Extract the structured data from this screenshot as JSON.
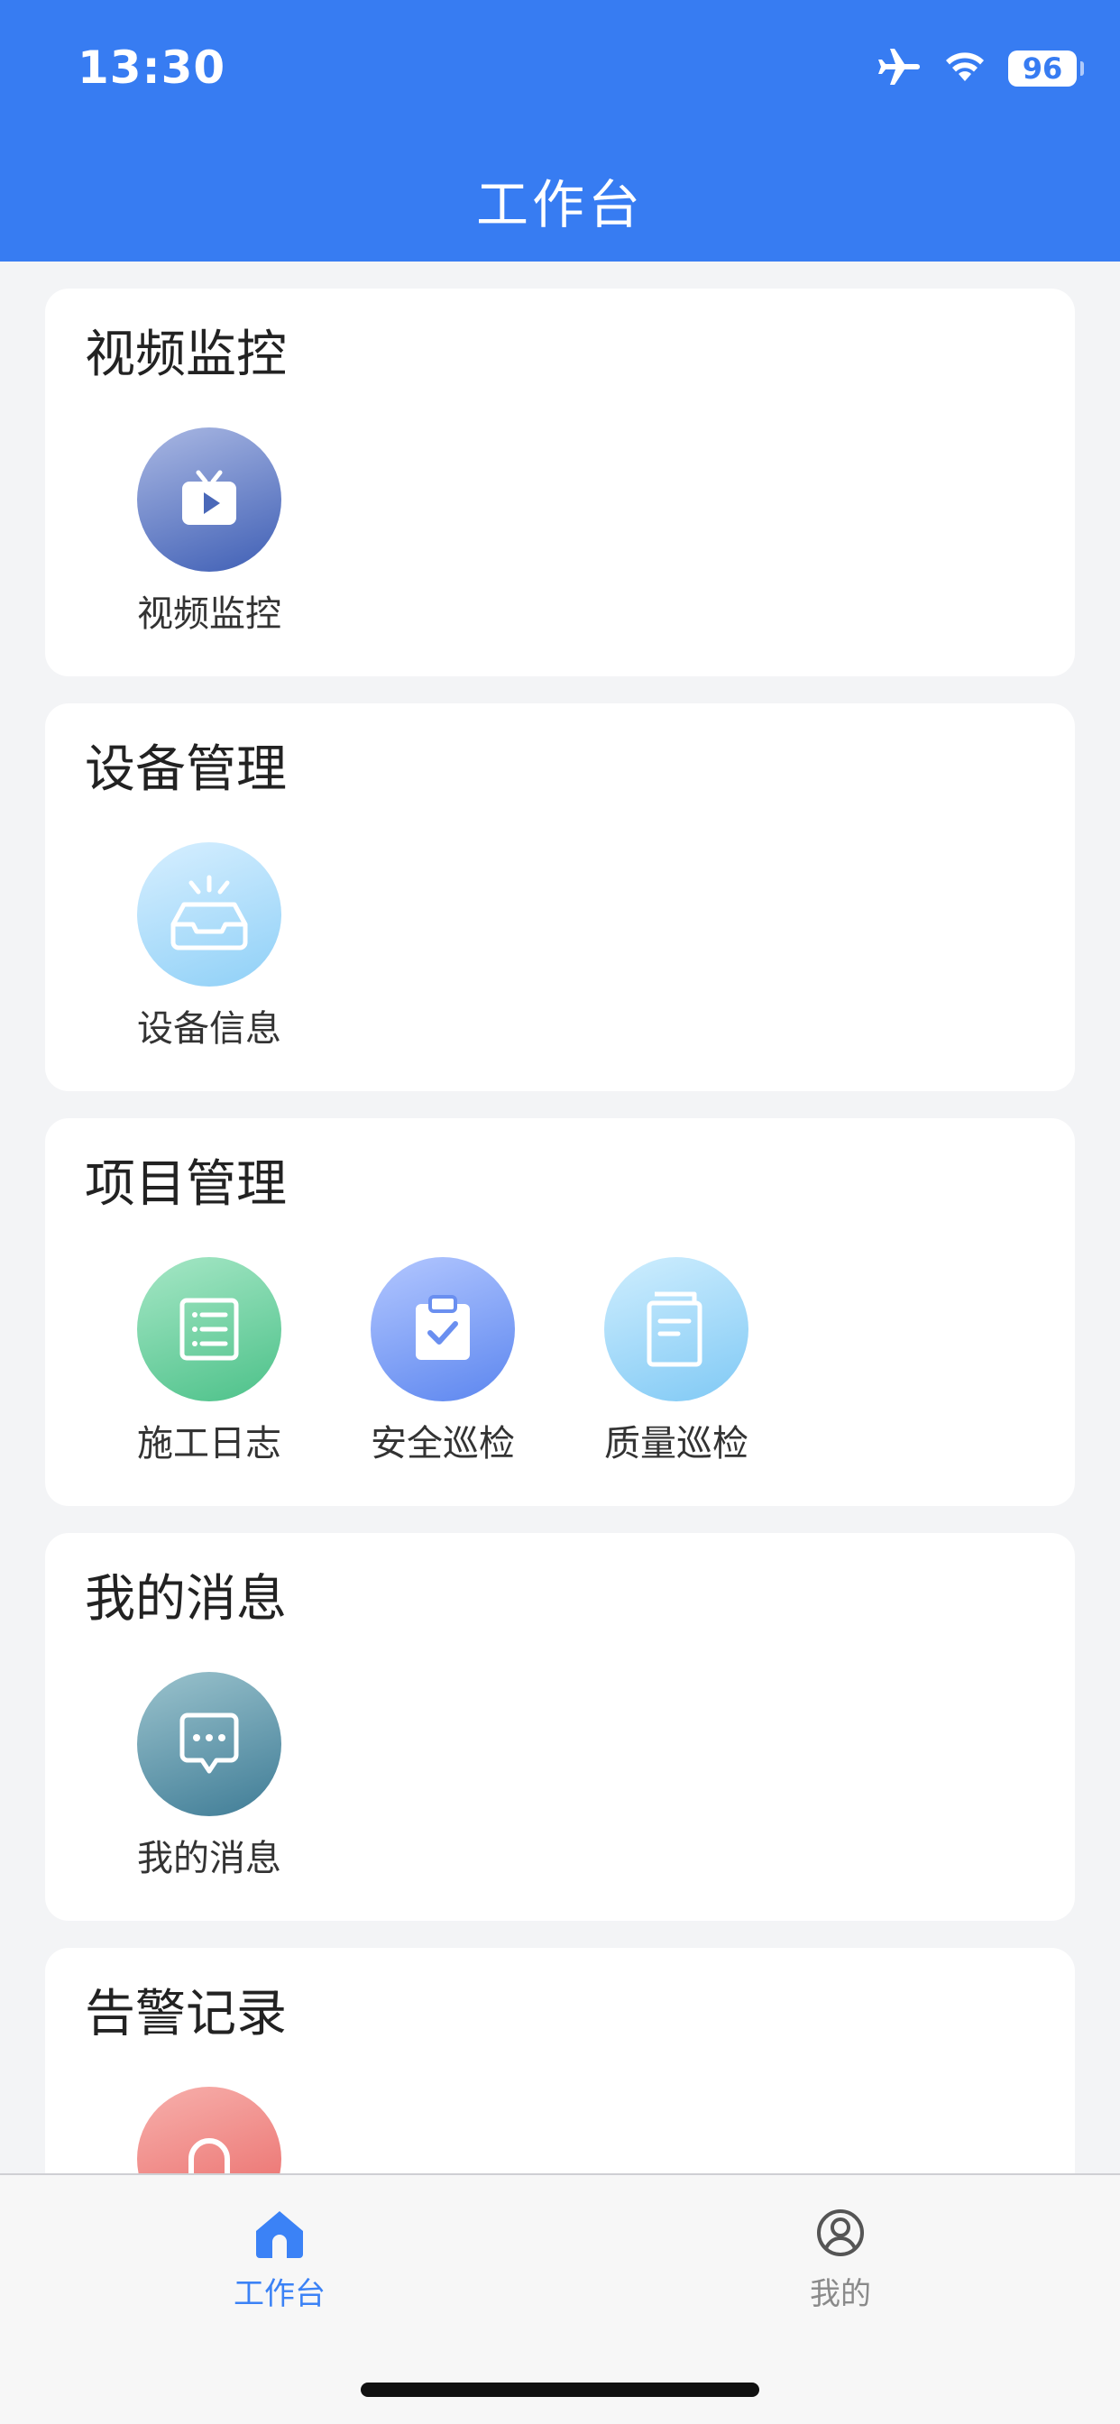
{
  "status_bar": {
    "time": "13:30",
    "battery": "96"
  },
  "header": {
    "title": "工作台"
  },
  "sections": [
    {
      "title": "视频监控",
      "items": [
        {
          "label": "视频监控",
          "icon": "tv-play-icon"
        }
      ]
    },
    {
      "title": "设备管理",
      "items": [
        {
          "label": "设备信息",
          "icon": "inbox-alert-icon"
        }
      ]
    },
    {
      "title": "项目管理",
      "items": [
        {
          "label": "施工日志",
          "icon": "list-doc-icon"
        },
        {
          "label": "安全巡检",
          "icon": "clipboard-check-icon"
        },
        {
          "label": "质量巡检",
          "icon": "document-icon"
        }
      ]
    },
    {
      "title": "我的消息",
      "items": [
        {
          "label": "我的消息",
          "icon": "chat-bubble-icon"
        }
      ]
    },
    {
      "title": "告警记录",
      "items": [
        {
          "label": "",
          "icon": "alarm-icon"
        }
      ]
    }
  ],
  "tabbar": {
    "items": [
      {
        "label": "工作台",
        "icon": "home-icon",
        "active": true
      },
      {
        "label": "我的",
        "icon": "user-circle-icon",
        "active": false
      }
    ]
  },
  "colors": {
    "header": "#377CF2",
    "accent": "#3B82F6",
    "background": "#F3F4F6"
  }
}
